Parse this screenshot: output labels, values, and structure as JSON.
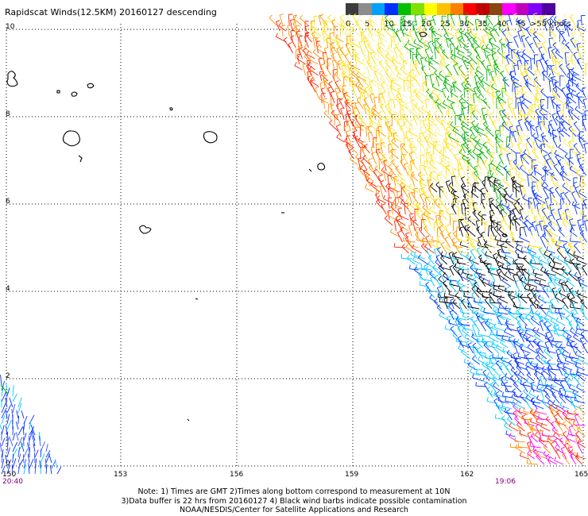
{
  "title": "Rapidscat Winds(12.5KM) 20160127 descending",
  "colorbar": {
    "labels": [
      "0",
      "5",
      "10",
      "15",
      "20",
      "25",
      "30",
      "35",
      "40",
      "45",
      ">50 knots"
    ],
    "colors": [
      "#3c3c3c",
      "#8c8c8c",
      "#00a0ff",
      "#0030ff",
      "#00c000",
      "#80e000",
      "#ffff00",
      "#ffc000",
      "#ff8000",
      "#ff0000",
      "#c00000",
      "#8b4513",
      "#ff00ff",
      "#c000c0",
      "#8000ff",
      "#5000a0"
    ]
  },
  "latitude_labels": [
    "10",
    "8",
    "6",
    "4",
    "2",
    "0"
  ],
  "longitude_labels": [
    "150",
    "153",
    "156",
    "159",
    "162",
    "165"
  ],
  "time_labels": {
    "left": "20:40",
    "right": "19:06"
  },
  "notes": [
    "Note: 1) Times are GMT 2)Times along bottom correspond to measurement at 10N",
    "3)Data buffer is 22 hrs from 20160127 4) Black wind barbs indicate possible contamination",
    "NOAA/NESDIS/Center for Satellite Applications and Research"
  ],
  "swath_colors": {
    "red": "#ff2000",
    "orange": "#ff9000",
    "yellow": "#ffe000",
    "paleyellow": "#f6ee8a",
    "green": "#00b000",
    "blue": "#0030ff",
    "cyan": "#00c8ff",
    "black": "#000000",
    "magenta": "#ff00ff"
  }
}
